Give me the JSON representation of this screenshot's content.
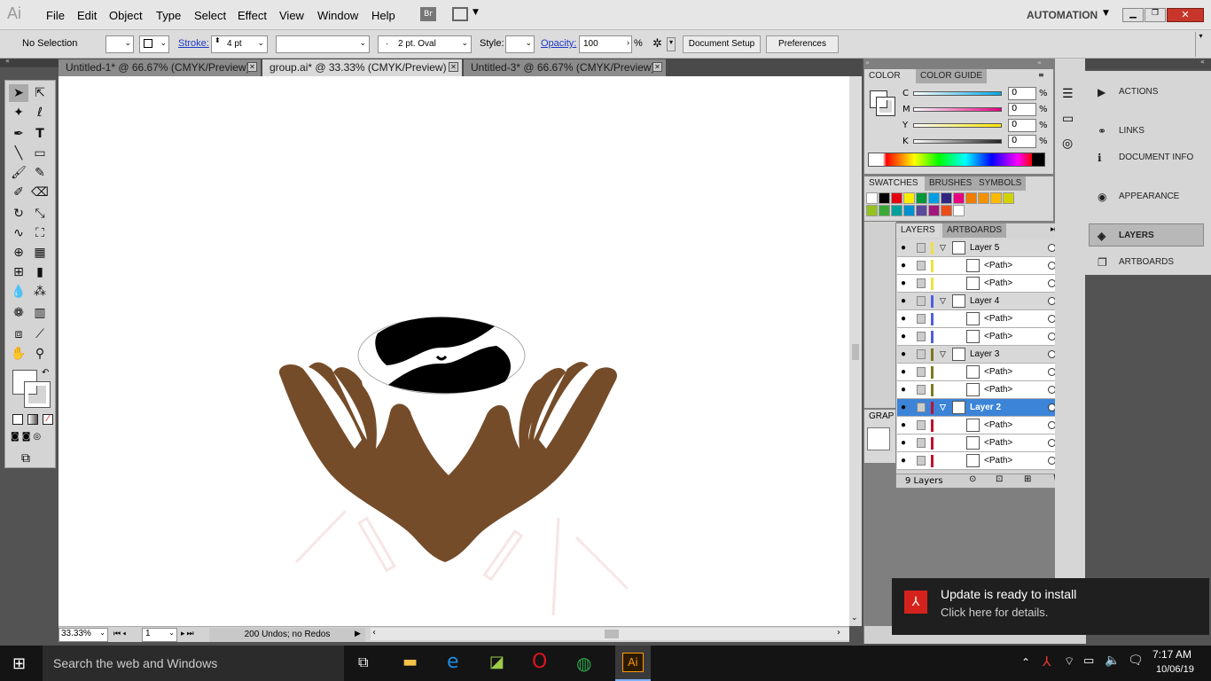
{
  "app": {
    "logo": "Ai",
    "workspace": "AUTOMATION",
    "bridge": "Br"
  },
  "menu": [
    "File",
    "Edit",
    "Object",
    "Type",
    "Select",
    "Effect",
    "View",
    "Window",
    "Help"
  ],
  "control": {
    "selection": "No Selection",
    "stroke_label": "Stroke:",
    "stroke_value": "4 pt",
    "brush_value": "2 pt. Oval",
    "brush_dot": "·",
    "style_label": "Style:",
    "opacity_label": "Opacity:",
    "opacity_value": "100",
    "opacity_unit": "%",
    "document_setup": "Document Setup",
    "preferences": "Preferences"
  },
  "tabs": [
    {
      "label": "Untitled-1* @ 66.67% (CMYK/Preview)"
    },
    {
      "label": "group.ai* @ 33.33% (CMYK/Preview)"
    },
    {
      "label": "Untitled-3* @ 66.67% (CMYK/Preview)"
    }
  ],
  "status": {
    "zoom": "33.33%",
    "artboard": "1",
    "undos": "200 Undos; no Redos"
  },
  "color_panel": {
    "tab_color": "COLOR",
    "tab_guide": "COLOR GUIDE",
    "channels": [
      {
        "name": "C",
        "value": "0",
        "unit": "%",
        "color": "#00a9e8"
      },
      {
        "name": "M",
        "value": "0",
        "unit": "%",
        "color": "#e6007e"
      },
      {
        "name": "Y",
        "value": "0",
        "unit": "%",
        "color": "#ffe600"
      },
      {
        "name": "K",
        "value": "0",
        "unit": "%",
        "color": "#222222"
      }
    ]
  },
  "swatch_tabs": [
    "SWATCHES",
    "BRUSHES",
    "SYMBOLS"
  ],
  "graphic_styles_tab": "GRAP",
  "swatch_colors": [
    "#ffffff",
    "#000000",
    "#e3000f",
    "#ffed00",
    "#00983a",
    "#009fe3",
    "#312782",
    "#e6007e",
    "#ef7d00",
    "#f39200",
    "#fbba00",
    "#d2d200",
    "#95c11f",
    "#3aaa35",
    "#00a19a",
    "#0090d0",
    "#5b4a9c",
    "#a2197d",
    "#e94e1b",
    "#ffffff"
  ],
  "layers_panel": {
    "tab_layers": "LAYERS",
    "tab_artboards": "ARTBOARDS",
    "footer": "9 Layers",
    "rows": [
      {
        "name": "Layer 5",
        "kind": "layer",
        "color": "#f0e040"
      },
      {
        "name": "<Path>",
        "kind": "sub",
        "color": "#f0e040"
      },
      {
        "name": "<Path>",
        "kind": "sub",
        "color": "#f0e040"
      },
      {
        "name": "Layer 4",
        "kind": "layer",
        "color": "#4f5fe0"
      },
      {
        "name": "<Path>",
        "kind": "sub",
        "color": "#4f5fe0"
      },
      {
        "name": "<Path>",
        "kind": "sub",
        "color": "#4f5fe0"
      },
      {
        "name": "Layer 3",
        "kind": "layer",
        "color": "#7a7a20"
      },
      {
        "name": "<Path>",
        "kind": "sub",
        "color": "#7a7a20"
      },
      {
        "name": "<Path>",
        "kind": "sub",
        "color": "#7a7a20"
      },
      {
        "name": "Layer 2",
        "kind": "sel",
        "color": "#c01030"
      },
      {
        "name": "<Path>",
        "kind": "sub",
        "color": "#c01030"
      },
      {
        "name": "<Path>",
        "kind": "sub",
        "color": "#c01030"
      },
      {
        "name": "<Path>",
        "kind": "sub",
        "color": "#c01030"
      }
    ]
  },
  "dock": [
    {
      "label": "ACTIONS"
    },
    {
      "label": "LINKS"
    },
    {
      "label": "DOCUMENT INFO"
    },
    {
      "label": "APPEARANCE"
    },
    {
      "label": "LAYERS"
    },
    {
      "label": "ARTBOARDS"
    }
  ],
  "toast": {
    "title": "Update is ready to install",
    "body": "Click here for details."
  },
  "taskbar": {
    "search": "Search the web and Windows",
    "time": "7:17 AM",
    "date": "10/06/19"
  }
}
